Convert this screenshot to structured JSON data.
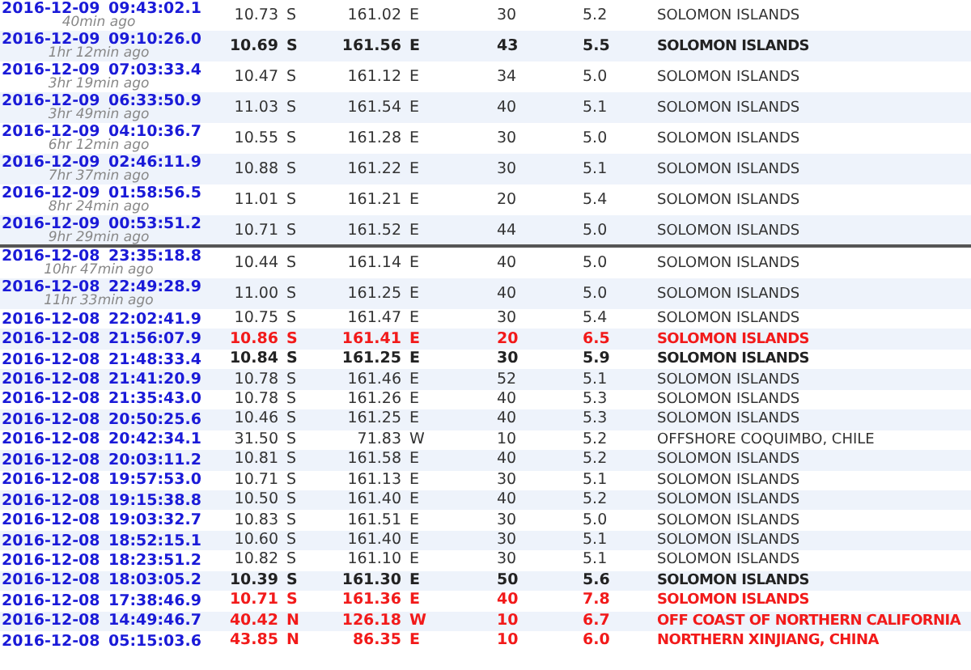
{
  "groups": [
    {
      "rows": [
        {
          "date": "2016-12-09",
          "time": "09:43:02.1",
          "ago": "40min ago",
          "lat": "10.73",
          "ns": "S",
          "lon": "161.02",
          "ew": "E",
          "depth": "30",
          "mag": "5.2",
          "region": "SOLOMON ISLANDS",
          "kind": "normal"
        },
        {
          "date": "2016-12-09",
          "time": "09:10:26.0",
          "ago": "1hr 12min ago",
          "lat": "10.69",
          "ns": "S",
          "lon": "161.56",
          "ew": "E",
          "depth": "43",
          "mag": "5.5",
          "region": "SOLOMON ISLANDS",
          "kind": "strong"
        },
        {
          "date": "2016-12-09",
          "time": "07:03:33.4",
          "ago": "3hr 19min ago",
          "lat": "10.47",
          "ns": "S",
          "lon": "161.12",
          "ew": "E",
          "depth": "34",
          "mag": "5.0",
          "region": "SOLOMON ISLANDS",
          "kind": "normal"
        },
        {
          "date": "2016-12-09",
          "time": "06:33:50.9",
          "ago": "3hr 49min ago",
          "lat": "11.03",
          "ns": "S",
          "lon": "161.54",
          "ew": "E",
          "depth": "40",
          "mag": "5.1",
          "region": "SOLOMON ISLANDS",
          "kind": "normal"
        },
        {
          "date": "2016-12-09",
          "time": "04:10:36.7",
          "ago": "6hr 12min ago",
          "lat": "10.55",
          "ns": "S",
          "lon": "161.28",
          "ew": "E",
          "depth": "30",
          "mag": "5.0",
          "region": "SOLOMON ISLANDS",
          "kind": "normal"
        },
        {
          "date": "2016-12-09",
          "time": "02:46:11.9",
          "ago": "7hr 37min ago",
          "lat": "10.88",
          "ns": "S",
          "lon": "161.22",
          "ew": "E",
          "depth": "30",
          "mag": "5.1",
          "region": "SOLOMON ISLANDS",
          "kind": "normal"
        },
        {
          "date": "2016-12-09",
          "time": "01:58:56.5",
          "ago": "8hr 24min ago",
          "lat": "11.01",
          "ns": "S",
          "lon": "161.21",
          "ew": "E",
          "depth": "20",
          "mag": "5.4",
          "region": "SOLOMON ISLANDS",
          "kind": "normal"
        },
        {
          "date": "2016-12-09",
          "time": "00:53:51.2",
          "ago": "9hr 29min ago",
          "lat": "10.71",
          "ns": "S",
          "lon": "161.52",
          "ew": "E",
          "depth": "44",
          "mag": "5.0",
          "region": "SOLOMON ISLANDS",
          "kind": "normal"
        }
      ]
    },
    {
      "rows": [
        {
          "date": "2016-12-08",
          "time": "23:35:18.8",
          "ago": "10hr 47min ago",
          "lat": "10.44",
          "ns": "S",
          "lon": "161.14",
          "ew": "E",
          "depth": "40",
          "mag": "5.0",
          "region": "SOLOMON ISLANDS",
          "kind": "normal"
        },
        {
          "date": "2016-12-08",
          "time": "22:49:28.9",
          "ago": "11hr 33min ago",
          "lat": "11.00",
          "ns": "S",
          "lon": "161.25",
          "ew": "E",
          "depth": "40",
          "mag": "5.0",
          "region": "SOLOMON ISLANDS",
          "kind": "normal"
        },
        {
          "date": "2016-12-08",
          "time": "22:02:41.9",
          "lat": "10.75",
          "ns": "S",
          "lon": "161.47",
          "ew": "E",
          "depth": "30",
          "mag": "5.4",
          "region": "SOLOMON ISLANDS",
          "kind": "normal"
        },
        {
          "date": "2016-12-08",
          "time": "21:56:07.9",
          "lat": "10.86",
          "ns": "S",
          "lon": "161.41",
          "ew": "E",
          "depth": "20",
          "mag": "6.5",
          "region": "SOLOMON ISLANDS",
          "kind": "alert"
        },
        {
          "date": "2016-12-08",
          "time": "21:48:33.4",
          "lat": "10.84",
          "ns": "S",
          "lon": "161.25",
          "ew": "E",
          "depth": "30",
          "mag": "5.9",
          "region": "SOLOMON ISLANDS",
          "kind": "strong"
        },
        {
          "date": "2016-12-08",
          "time": "21:41:20.9",
          "lat": "10.78",
          "ns": "S",
          "lon": "161.46",
          "ew": "E",
          "depth": "52",
          "mag": "5.1",
          "region": "SOLOMON ISLANDS",
          "kind": "normal"
        },
        {
          "date": "2016-12-08",
          "time": "21:35:43.0",
          "lat": "10.78",
          "ns": "S",
          "lon": "161.26",
          "ew": "E",
          "depth": "40",
          "mag": "5.3",
          "region": "SOLOMON ISLANDS",
          "kind": "normal"
        },
        {
          "date": "2016-12-08",
          "time": "20:50:25.6",
          "lat": "10.46",
          "ns": "S",
          "lon": "161.25",
          "ew": "E",
          "depth": "40",
          "mag": "5.3",
          "region": "SOLOMON ISLANDS",
          "kind": "normal"
        },
        {
          "date": "2016-12-08",
          "time": "20:42:34.1",
          "lat": "31.50",
          "ns": "S",
          "lon": "71.83",
          "ew": "W",
          "depth": "10",
          "mag": "5.2",
          "region": "OFFSHORE COQUIMBO, CHILE",
          "kind": "normal"
        },
        {
          "date": "2016-12-08",
          "time": "20:03:11.2",
          "lat": "10.81",
          "ns": "S",
          "lon": "161.58",
          "ew": "E",
          "depth": "40",
          "mag": "5.2",
          "region": "SOLOMON ISLANDS",
          "kind": "normal"
        },
        {
          "date": "2016-12-08",
          "time": "19:57:53.0",
          "lat": "10.71",
          "ns": "S",
          "lon": "161.13",
          "ew": "E",
          "depth": "30",
          "mag": "5.1",
          "region": "SOLOMON ISLANDS",
          "kind": "normal"
        },
        {
          "date": "2016-12-08",
          "time": "19:15:38.8",
          "lat": "10.50",
          "ns": "S",
          "lon": "161.40",
          "ew": "E",
          "depth": "40",
          "mag": "5.2",
          "region": "SOLOMON ISLANDS",
          "kind": "normal"
        },
        {
          "date": "2016-12-08",
          "time": "19:03:32.7",
          "lat": "10.83",
          "ns": "S",
          "lon": "161.51",
          "ew": "E",
          "depth": "30",
          "mag": "5.0",
          "region": "SOLOMON ISLANDS",
          "kind": "normal"
        },
        {
          "date": "2016-12-08",
          "time": "18:52:15.1",
          "lat": "10.60",
          "ns": "S",
          "lon": "161.40",
          "ew": "E",
          "depth": "30",
          "mag": "5.1",
          "region": "SOLOMON ISLANDS",
          "kind": "normal"
        },
        {
          "date": "2016-12-08",
          "time": "18:23:51.2",
          "lat": "10.82",
          "ns": "S",
          "lon": "161.10",
          "ew": "E",
          "depth": "30",
          "mag": "5.1",
          "region": "SOLOMON ISLANDS",
          "kind": "normal"
        },
        {
          "date": "2016-12-08",
          "time": "18:03:05.2",
          "lat": "10.39",
          "ns": "S",
          "lon": "161.30",
          "ew": "E",
          "depth": "50",
          "mag": "5.6",
          "region": "SOLOMON ISLANDS",
          "kind": "strong"
        },
        {
          "date": "2016-12-08",
          "time": "17:38:46.9",
          "lat": "10.71",
          "ns": "S",
          "lon": "161.36",
          "ew": "E",
          "depth": "40",
          "mag": "7.8",
          "region": "SOLOMON ISLANDS",
          "kind": "alert"
        },
        {
          "date": "2016-12-08",
          "time": "14:49:46.7",
          "lat": "40.42",
          "ns": "N",
          "lon": "126.18",
          "ew": "W",
          "depth": "10",
          "mag": "6.7",
          "region": "OFF COAST OF NORTHERN CALIFORNIA",
          "kind": "alert"
        },
        {
          "date": "2016-12-08",
          "time": "05:15:03.6",
          "lat": "43.85",
          "ns": "N",
          "lon": "86.35",
          "ew": "E",
          "depth": "10",
          "mag": "6.0",
          "region": "NORTHERN XINJIANG, CHINA",
          "kind": "alert"
        }
      ]
    }
  ]
}
